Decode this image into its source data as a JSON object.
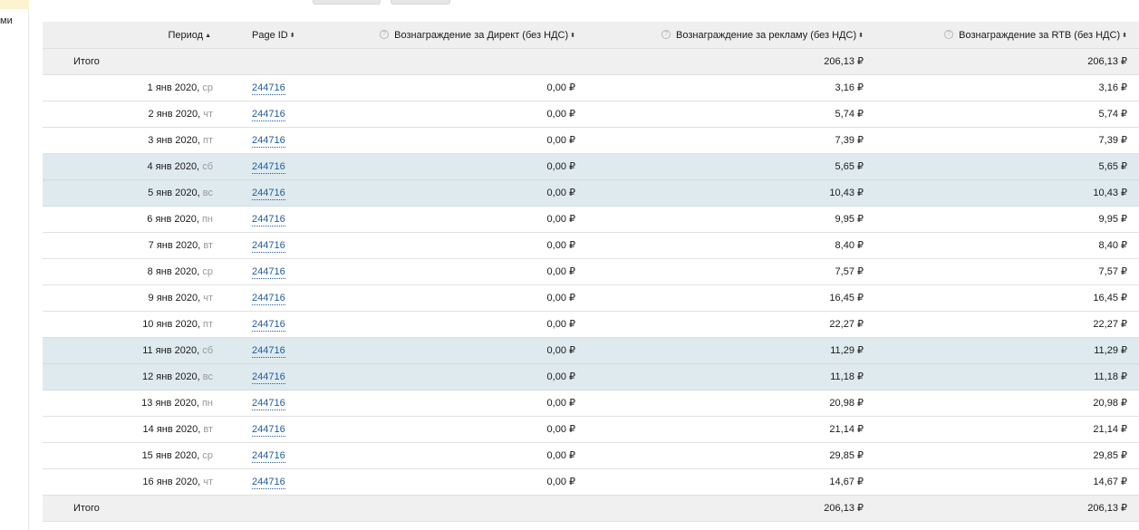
{
  "left_panel": {
    "label": "ми"
  },
  "header": {
    "period": "Период",
    "period_sort": "▲",
    "page_id": "Page ID",
    "page_id_sort": "⬍",
    "direct": "Вознаграждение за Директ (без НДС)",
    "direct_sort": "⬍",
    "ads": "Вознаграждение за рекламу (без НДС)",
    "ads_sort": "⬍",
    "rtb": "Вознаграждение за RTB (без НДС)",
    "rtb_sort": "⬍",
    "help_glyph": "?"
  },
  "total_top": {
    "label": "Итого",
    "ads": "206,13 ₽",
    "rtb": "206,13 ₽"
  },
  "rows": [
    {
      "date": "1 янв 2020,",
      "weekday": "ср",
      "page_id": "244716",
      "direct": "0,00 ₽",
      "ads": "3,16 ₽",
      "rtb": "3,16 ₽"
    },
    {
      "date": "2 янв 2020,",
      "weekday": "чт",
      "page_id": "244716",
      "direct": "0,00 ₽",
      "ads": "5,74 ₽",
      "rtb": "5,74 ₽"
    },
    {
      "date": "3 янв 2020,",
      "weekday": "пт",
      "page_id": "244716",
      "direct": "0,00 ₽",
      "ads": "7,39 ₽",
      "rtb": "7,39 ₽"
    },
    {
      "date": "4 янв 2020,",
      "weekday": "сб",
      "page_id": "244716",
      "direct": "0,00 ₽",
      "ads": "5,65 ₽",
      "rtb": "5,65 ₽"
    },
    {
      "date": "5 янв 2020,",
      "weekday": "вс",
      "page_id": "244716",
      "direct": "0,00 ₽",
      "ads": "10,43 ₽",
      "rtb": "10,43 ₽"
    },
    {
      "date": "6 янв 2020,",
      "weekday": "пн",
      "page_id": "244716",
      "direct": "0,00 ₽",
      "ads": "9,95 ₽",
      "rtb": "9,95 ₽"
    },
    {
      "date": "7 янв 2020,",
      "weekday": "вт",
      "page_id": "244716",
      "direct": "0,00 ₽",
      "ads": "8,40 ₽",
      "rtb": "8,40 ₽"
    },
    {
      "date": "8 янв 2020,",
      "weekday": "ср",
      "page_id": "244716",
      "direct": "0,00 ₽",
      "ads": "7,57 ₽",
      "rtb": "7,57 ₽"
    },
    {
      "date": "9 янв 2020,",
      "weekday": "чт",
      "page_id": "244716",
      "direct": "0,00 ₽",
      "ads": "16,45 ₽",
      "rtb": "16,45 ₽"
    },
    {
      "date": "10 янв 2020,",
      "weekday": "пт",
      "page_id": "244716",
      "direct": "0,00 ₽",
      "ads": "22,27 ₽",
      "rtb": "22,27 ₽"
    },
    {
      "date": "11 янв 2020,",
      "weekday": "сб",
      "page_id": "244716",
      "direct": "0,00 ₽",
      "ads": "11,29 ₽",
      "rtb": "11,29 ₽"
    },
    {
      "date": "12 янв 2020,",
      "weekday": "вс",
      "page_id": "244716",
      "direct": "0,00 ₽",
      "ads": "11,18 ₽",
      "rtb": "11,18 ₽"
    },
    {
      "date": "13 янв 2020,",
      "weekday": "пн",
      "page_id": "244716",
      "direct": "0,00 ₽",
      "ads": "20,98 ₽",
      "rtb": "20,98 ₽"
    },
    {
      "date": "14 янв 2020,",
      "weekday": "вт",
      "page_id": "244716",
      "direct": "0,00 ₽",
      "ads": "21,14 ₽",
      "rtb": "21,14 ₽"
    },
    {
      "date": "15 янв 2020,",
      "weekday": "ср",
      "page_id": "244716",
      "direct": "0,00 ₽",
      "ads": "29,85 ₽",
      "rtb": "29,85 ₽"
    },
    {
      "date": "16 янв 2020,",
      "weekday": "чт",
      "page_id": "244716",
      "direct": "0,00 ₽",
      "ads": "14,67 ₽",
      "rtb": "14,67 ₽"
    }
  ],
  "total_bottom": {
    "label": "Итого",
    "ads": "206,13 ₽",
    "rtb": "206,13 ₽"
  },
  "colors": {
    "row_bg": "#ffffff",
    "weekend_bg": "#dfeaee",
    "header_bg": "#efefef",
    "total_bg": "#f0f0f0",
    "link": "#1f5b9c",
    "weekday": "#999999"
  }
}
